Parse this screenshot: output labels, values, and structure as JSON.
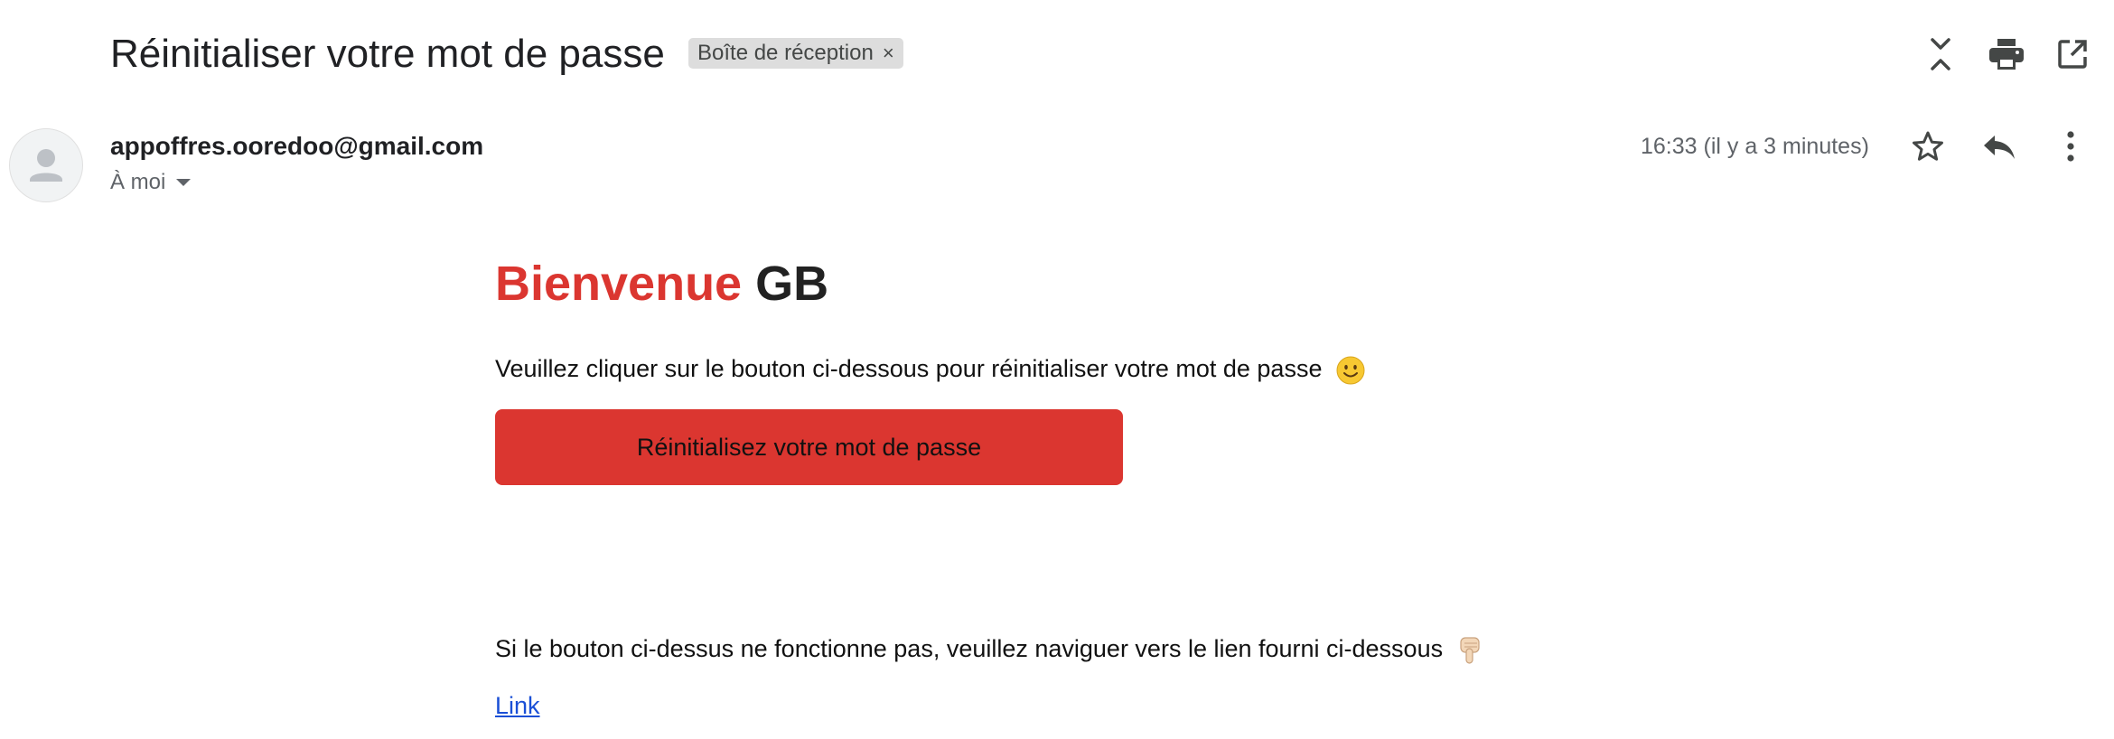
{
  "header": {
    "subject": "Réinitialiser votre mot de passe",
    "label": "Boîte de réception",
    "label_remove": "×"
  },
  "toolbar": {
    "icons": [
      "collapse-all-icon",
      "print-icon",
      "open-in-new-window-icon"
    ]
  },
  "message": {
    "sender_email": "appoffres.ooredoo@gmail.com",
    "recipient": "À moi",
    "timestamp": "16:33 (il y a 3 minutes)",
    "actions": [
      "star-icon",
      "reply-icon",
      "more-vert-icon"
    ]
  },
  "body": {
    "greeting_word": "Bienvenue",
    "greeting_name": "GB",
    "instruction": "Veuillez cliquer sur le bouton ci-dessous pour réinitialiser votre mot de passe",
    "button_label": "Réinitialisez votre mot de passe",
    "fallback_text": "Si le bouton ci-dessus ne fonctionne pas, veuillez naviguer vers le lien fourni ci-dessous",
    "link_text": "Link"
  },
  "colors": {
    "accent_red": "#db3630",
    "link_blue": "#1a4fd6",
    "label_chip_bg": "#dddddd",
    "muted_text": "#5f6368"
  }
}
